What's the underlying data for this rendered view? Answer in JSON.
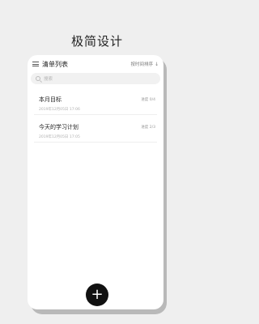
{
  "headline": "极简设计",
  "app": {
    "title": "清单列表",
    "sort_label": "按时间排序",
    "sort_arrow": "↓"
  },
  "search": {
    "placeholder": "搜索"
  },
  "tasks": [
    {
      "title": "本月目标",
      "progress": "进度 0/4",
      "date": "2019年12月05日 17:06"
    },
    {
      "title": "今天的学习计划",
      "progress": "进度 2/3",
      "date": "2019年12月05日 17:05"
    }
  ],
  "fab": {
    "label": "+"
  }
}
